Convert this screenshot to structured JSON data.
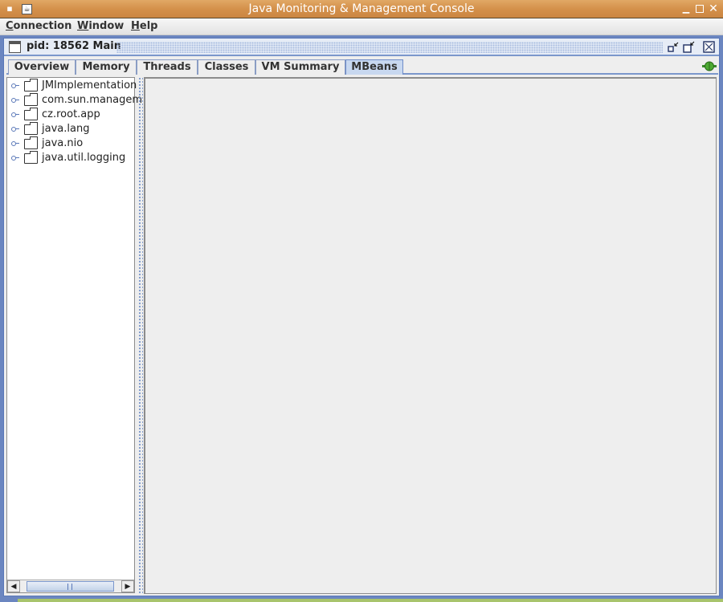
{
  "window": {
    "title": "Java Monitoring & Management Console"
  },
  "menu": [
    {
      "label": "Connection",
      "mnemonic": "C",
      "rest": "onnection"
    },
    {
      "label": "Window",
      "mnemonic": "W",
      "rest": "indow"
    },
    {
      "label": "Help",
      "mnemonic": "H",
      "rest": "elp"
    }
  ],
  "frame": {
    "title": "pid: 18562 Main"
  },
  "tabs": [
    {
      "label": "Overview"
    },
    {
      "label": "Memory"
    },
    {
      "label": "Threads"
    },
    {
      "label": "Classes"
    },
    {
      "label": "VM Summary"
    },
    {
      "label": "MBeans",
      "active": true
    }
  ],
  "tree": [
    {
      "label": "JMImplementation"
    },
    {
      "label": "com.sun.managem"
    },
    {
      "label": "cz.root.app"
    },
    {
      "label": "java.lang"
    },
    {
      "label": "java.nio"
    },
    {
      "label": "java.util.logging"
    }
  ],
  "colors": {
    "accent": "#6b86c0",
    "titlebar": "#d4914b",
    "connected": "#3a8a2a"
  }
}
